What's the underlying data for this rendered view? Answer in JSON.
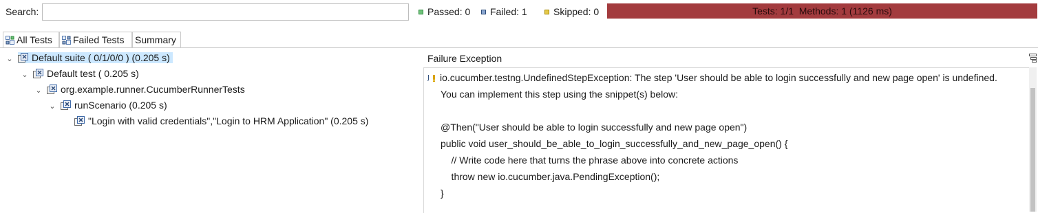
{
  "search": {
    "label": "Search:",
    "value": "",
    "placeholder": ""
  },
  "stats": {
    "passed": "Passed: 0",
    "failed": "Failed: 1",
    "skipped": "Skipped: 0",
    "progress_text": "Tests: 1/1  Methods: 1 (1126 ms)",
    "progress_fraction": 1.0,
    "progress_color": "#a33b3e"
  },
  "tabs": [
    {
      "label": "All Tests",
      "icon": "all-tests-icon",
      "active": true
    },
    {
      "label": "Failed Tests",
      "icon": "failed-tests-icon",
      "active": false
    },
    {
      "label": "Summary",
      "active": false
    }
  ],
  "tree": [
    {
      "label": "Default suite ( 0/1/0/0 ) (0.205 s)",
      "expanded": true,
      "selected": true,
      "icon": "suite-failed-icon"
    },
    {
      "label": "Default test ( 0.205 s)",
      "expanded": true,
      "icon": "test-failed-icon"
    },
    {
      "label": "org.example.runner.CucumberRunnerTests",
      "expanded": true,
      "icon": "class-failed-icon"
    },
    {
      "label": "runScenario  (0.205 s)",
      "expanded": true,
      "icon": "method-failed-icon"
    },
    {
      "label": "\"Login with valid credentials\",\"Login to HRM Application\"  (0.205 s)",
      "icon": "instance-failed-icon"
    }
  ],
  "detail": {
    "header": "Failure Exception",
    "lines": [
      "io.cucumber.testng.UndefinedStepException: The step 'User should be able to login successfully and new page open' is undefined.",
      "You can implement this step using the snippet(s) below:",
      "",
      "@Then(\"User should be able to login successfully and new page open\")",
      "public void user_should_be_able_to_login_successfully_and_new_page_open() {",
      "    // Write code here that turns the phrase above into concrete actions",
      "    throw new io.cucumber.java.PendingException();",
      "}"
    ]
  },
  "colors": {
    "selection": "#cce8ff",
    "fail_bar": "#a33b3e"
  }
}
